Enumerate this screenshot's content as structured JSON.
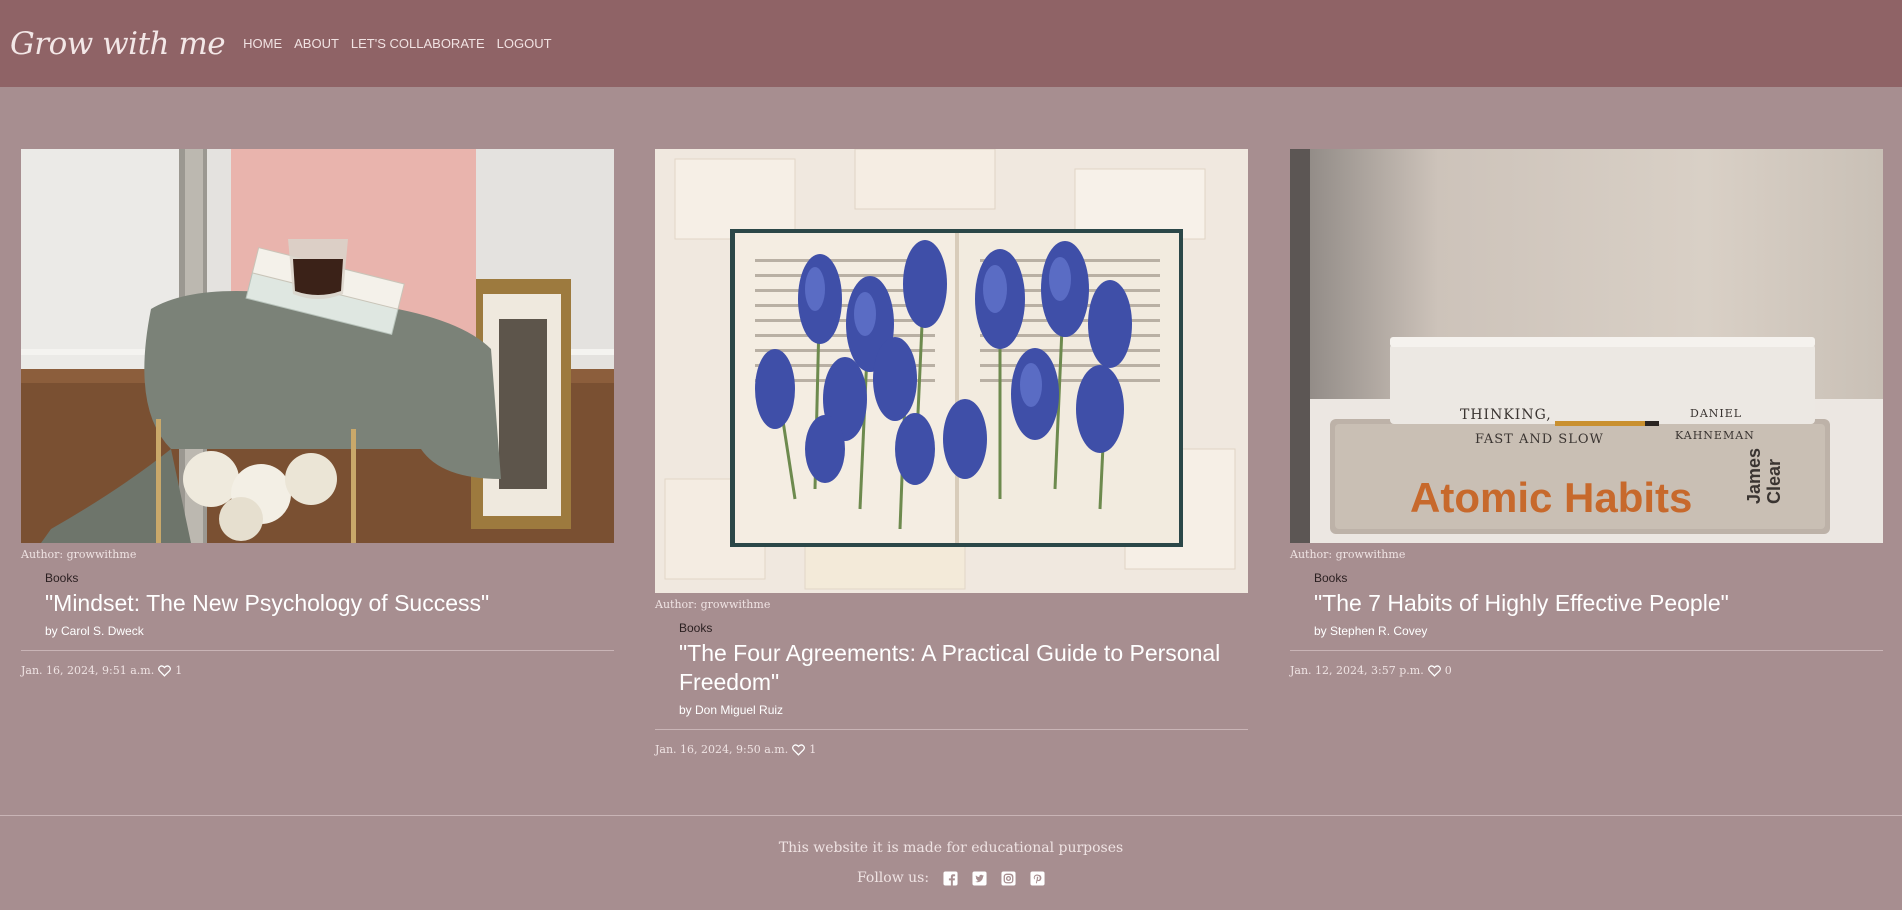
{
  "header": {
    "brand": "Grow with me",
    "nav": [
      "HOME",
      "ABOUT",
      "LET'S COLLABORATE",
      "LOGOUT"
    ]
  },
  "posts": [
    {
      "author": "Author: growwithme",
      "category": "Books",
      "title": "\"Mindset: The New Psychology of Success\"",
      "byline": "by Carol S. Dweck",
      "date": "Jan. 16, 2024, 9:51 a.m.",
      "likes": "1"
    },
    {
      "author": "Author: growwithme",
      "category": "Books",
      "title": "\"The Four Agreements: A Practical Guide to Personal Freedom\"",
      "byline": "by Don Miguel Ruiz",
      "date": "Jan. 16, 2024, 9:50 a.m.",
      "likes": "1"
    },
    {
      "author": "Author: growwithme",
      "category": "Books",
      "title": "\"The 7 Habits of Highly Effective People\"",
      "byline": "by Stephen R. Covey",
      "date": "Jan. 12, 2024, 3:57 p.m.",
      "likes": "0",
      "image_book_spines": {
        "top_title": "THINKING, FAST AND SLOW",
        "top_author": "DANIEL KAHNEMAN",
        "bottom_title": "Atomic Habits",
        "bottom_author": "James Clear"
      }
    }
  ],
  "footer": {
    "text": "This website it is made for educational purposes",
    "follow": "Follow us:",
    "social_icons": [
      "facebook-icon",
      "twitter-icon",
      "instagram-icon",
      "pinterest-icon"
    ]
  },
  "colors": {
    "header_bg": "#8f6366",
    "page_bg": "#a78e90"
  }
}
